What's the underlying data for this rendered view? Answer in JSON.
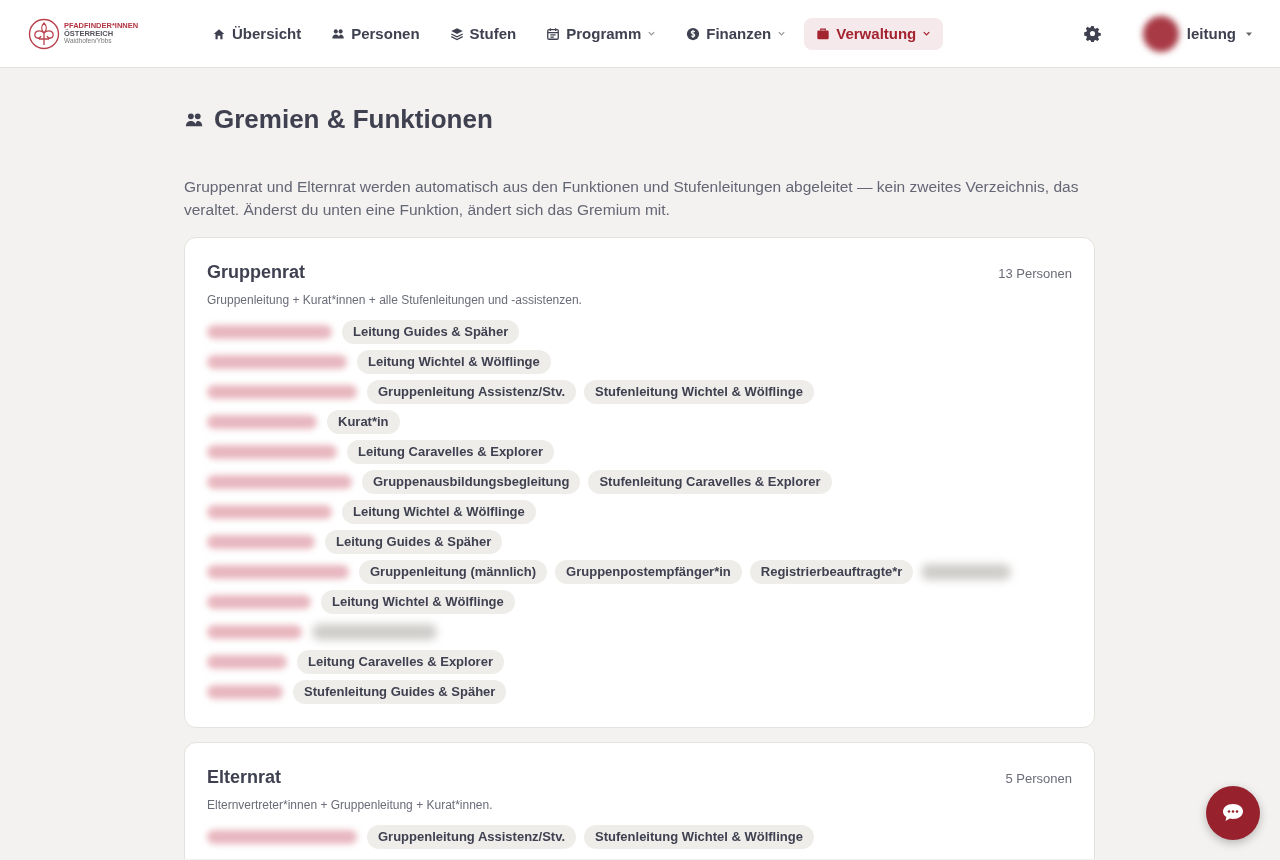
{
  "logo": {
    "line1": "PFADFINDER*INNEN",
    "line2": "ÖSTERREICH",
    "line3": "Waidhofen/Ybbs"
  },
  "nav": [
    {
      "label": "Übersicht",
      "dropdown": false,
      "selected": false
    },
    {
      "label": "Personen",
      "dropdown": false,
      "selected": false
    },
    {
      "label": "Stufen",
      "dropdown": false,
      "selected": false
    },
    {
      "label": "Programm",
      "dropdown": true,
      "selected": false
    },
    {
      "label": "Finanzen",
      "dropdown": true,
      "selected": false
    },
    {
      "label": "Verwaltung",
      "dropdown": true,
      "selected": true
    }
  ],
  "user": {
    "name": "leitung"
  },
  "page": {
    "title": "Gremien & Funktionen",
    "intro": "Gruppenrat und Elternrat werden automatisch aus den Funktionen und Stufenleitungen abgeleitet — kein zweites Verzeichnis, das veraltet. Änderst du unten eine Funktion, ändert sich das Gremium mit."
  },
  "committees": [
    {
      "name": "Gruppenrat",
      "count": "13 Personen",
      "description": "Gruppenleitung + Kurat*innen + alle Stufenleitungen und -assistenzen.",
      "members": [
        {
          "name_redacted": true,
          "tags": [
            {
              "label": "Leitung Guides & Späher"
            }
          ]
        },
        {
          "name_redacted": true,
          "tags": [
            {
              "label": "Leitung Wichtel & Wölflinge"
            }
          ]
        },
        {
          "name_redacted": true,
          "tags": [
            {
              "label": "Gruppenleitung Assistenz/Stv."
            },
            {
              "label": "Stufenleitung Wichtel & Wölflinge"
            }
          ]
        },
        {
          "name_redacted": true,
          "tags": [
            {
              "label": "Kurat*in"
            }
          ]
        },
        {
          "name_redacted": true,
          "tags": [
            {
              "label": "Leitung Caravelles & Explorer"
            }
          ]
        },
        {
          "name_redacted": true,
          "tags": [
            {
              "label": "Gruppenausbildungsbegleitung"
            },
            {
              "label": "Stufenleitung Caravelles & Explorer"
            }
          ]
        },
        {
          "name_redacted": true,
          "tags": [
            {
              "label": "Leitung Wichtel & Wölflinge"
            }
          ]
        },
        {
          "name_redacted": true,
          "tags": [
            {
              "label": "Leitung Guides & Späher"
            }
          ]
        },
        {
          "name_redacted": true,
          "tags": [
            {
              "label": "Gruppenleitung (männlich)"
            },
            {
              "label": "Gruppenpostempfänger*in"
            },
            {
              "label": "Registrierbeauftragte*r"
            },
            {
              "redacted": true
            }
          ]
        },
        {
          "name_redacted": true,
          "tags": [
            {
              "label": "Leitung Wichtel & Wölflinge"
            }
          ]
        },
        {
          "name_redacted": true,
          "tags": [
            {
              "redacted": true
            }
          ]
        },
        {
          "name_redacted": true,
          "tags": [
            {
              "label": "Leitung Caravelles & Explorer"
            }
          ]
        },
        {
          "name_redacted": true,
          "tags": [
            {
              "label": "Stufenleitung Guides & Späher"
            }
          ]
        }
      ]
    },
    {
      "name": "Elternrat",
      "count": "5 Personen",
      "description": "Elternvertreter*innen + Gruppenleitung + Kurat*innen.",
      "members": [
        {
          "name_redacted": true,
          "tags": [
            {
              "label": "Gruppenleitung Assistenz/Stv."
            },
            {
              "label": "Stufenleitung Wichtel & Wölflinge"
            }
          ]
        }
      ]
    }
  ]
}
